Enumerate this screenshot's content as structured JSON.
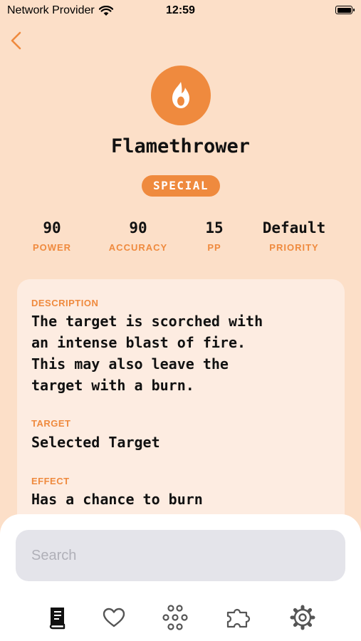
{
  "status_bar": {
    "carrier": "Network Provider",
    "time": "12:59"
  },
  "move": {
    "name": "Flamethrower",
    "category": "SPECIAL",
    "icon": "flame-icon",
    "accent_color": "#ef8a3e"
  },
  "stats": [
    {
      "value": "90",
      "label": "POWER"
    },
    {
      "value": "90",
      "label": "ACCURACY"
    },
    {
      "value": "15",
      "label": "PP"
    },
    {
      "value": "Default",
      "label": "PRIORITY"
    }
  ],
  "details": {
    "description_label": "DESCRIPTION",
    "description_lines": [
      "The target is scorched with",
      "an intense blast of fire.",
      "This may also leave the",
      "target with a burn."
    ],
    "target_label": "TARGET",
    "target": "Selected Target",
    "effect_label": "EFFECT",
    "effect": "Has a chance to burn"
  },
  "search": {
    "placeholder": "Search"
  },
  "tabs": [
    {
      "icon": "book-icon",
      "active": true
    },
    {
      "icon": "heart-icon",
      "active": false
    },
    {
      "icon": "ring-nodes-icon",
      "active": false
    },
    {
      "icon": "puzzle-icon",
      "active": false
    },
    {
      "icon": "gear-icon",
      "active": false
    }
  ]
}
